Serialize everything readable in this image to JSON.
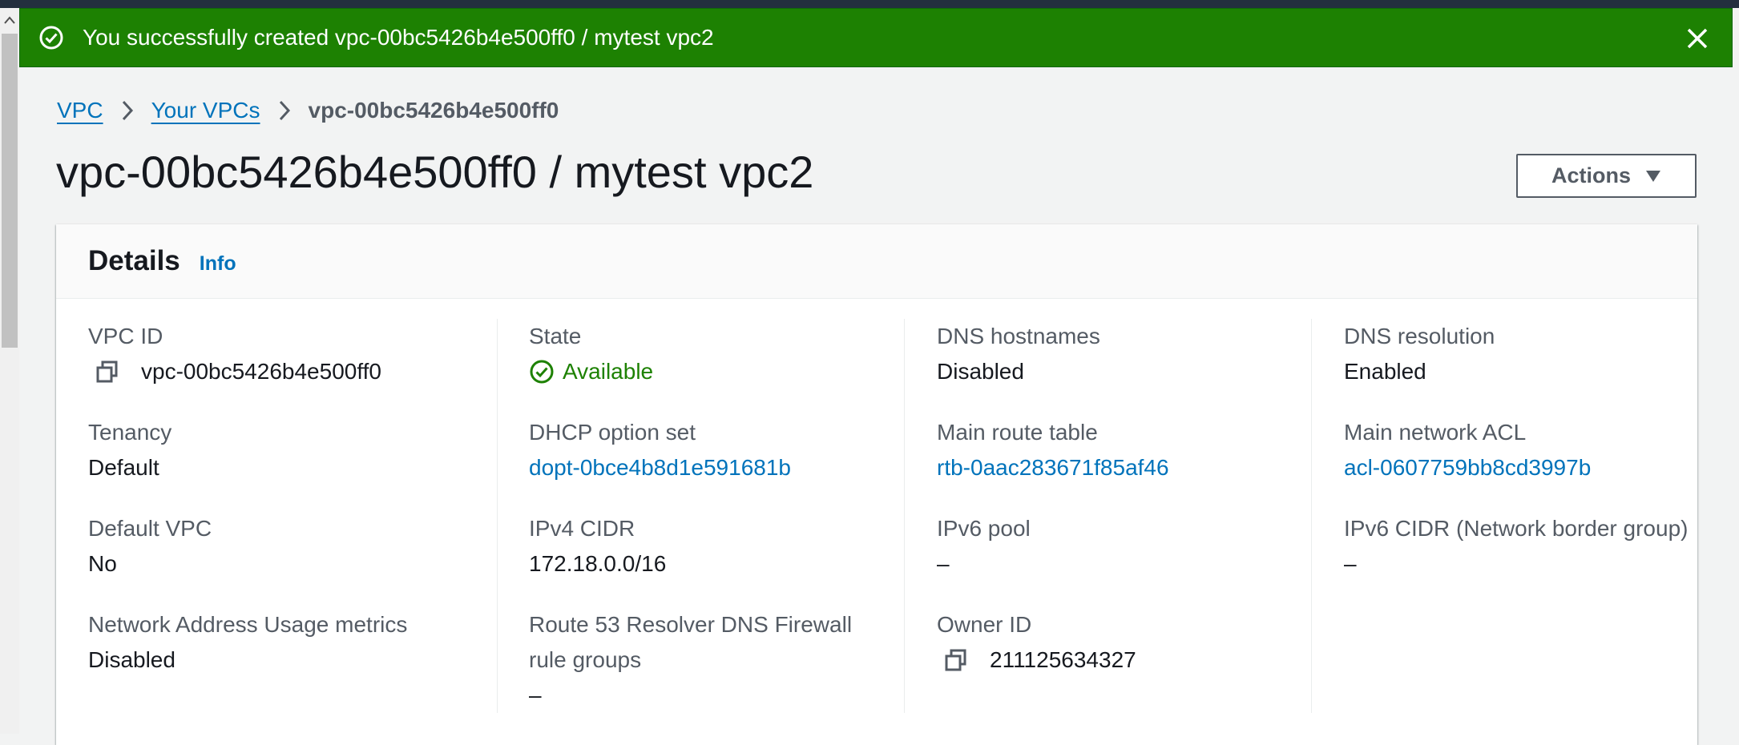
{
  "flash": {
    "message": "You successfully created vpc-00bc5426b4e500ff0 / mytest vpc2",
    "success_color": "#1d8102",
    "icon": "check-circle-icon",
    "close_icon": "close-icon"
  },
  "breadcrumb": {
    "items": [
      {
        "label": "VPC"
      },
      {
        "label": "Your VPCs"
      }
    ],
    "current": "vpc-00bc5426b4e500ff0"
  },
  "page": {
    "title": "vpc-00bc5426b4e500ff0 / mytest vpc2",
    "actions_label": "Actions"
  },
  "details": {
    "title": "Details",
    "info_label": "Info",
    "columns": [
      [
        {
          "label": "VPC ID",
          "value": "vpc-00bc5426b4e500ff0"
        },
        {
          "label": "Tenancy",
          "value": "Default"
        },
        {
          "label": "Default VPC",
          "value": "No"
        },
        {
          "label": "Network Address Usage metrics",
          "value": "Disabled"
        }
      ],
      [
        {
          "label": "State",
          "value": "Available"
        },
        {
          "label": "DHCP option set",
          "value": "dopt-0bce4b8d1e591681b"
        },
        {
          "label": "IPv4 CIDR",
          "value": "172.18.0.0/16"
        },
        {
          "label": "Route 53 Resolver DNS Firewall rule groups",
          "value": "–"
        }
      ],
      [
        {
          "label": "DNS hostnames",
          "value": "Disabled"
        },
        {
          "label": "Main route table",
          "value": "rtb-0aac283671f85af46"
        },
        {
          "label": "IPv6 pool",
          "value": "–"
        },
        {
          "label": "Owner ID",
          "value": "211125634327"
        }
      ],
      [
        {
          "label": "DNS resolution",
          "value": "Enabled"
        },
        {
          "label": "Main network ACL",
          "value": "acl-0607759bb8cd3997b"
        },
        {
          "label": "IPv6 CIDR (Network border group)",
          "value": "–"
        }
      ]
    ],
    "link_color": "#0073bb"
  }
}
